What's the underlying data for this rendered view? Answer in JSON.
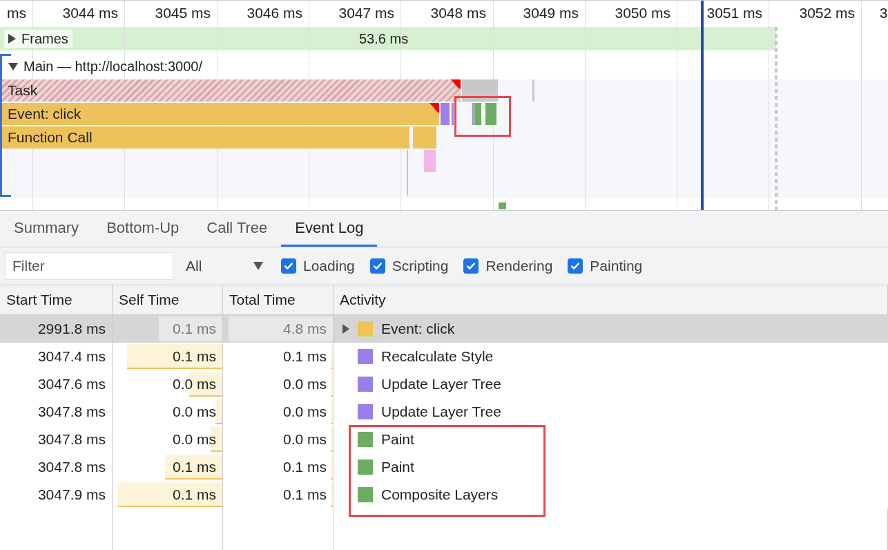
{
  "timeline": {
    "ticks": [
      "ms",
      "3044 ms",
      "3045 ms",
      "3046 ms",
      "3047 ms",
      "3048 ms",
      "3049 ms",
      "3050 ms",
      "3051 ms",
      "3052 ms",
      "3"
    ],
    "frames": {
      "label": "Frames",
      "expanded": false,
      "duration": "53.6 ms"
    },
    "main": {
      "label": "Main — http://localhost:3000/",
      "expanded": true
    },
    "events": [
      {
        "label": "Task",
        "kind": "task"
      },
      {
        "label": "Event: click",
        "kind": "scripting"
      },
      {
        "label": "Function Call",
        "kind": "scripting"
      }
    ]
  },
  "tabs": [
    {
      "label": "Summary",
      "selected": false
    },
    {
      "label": "Bottom-Up",
      "selected": false
    },
    {
      "label": "Call Tree",
      "selected": false
    },
    {
      "label": "Event Log",
      "selected": true
    }
  ],
  "filter": {
    "placeholder": "Filter"
  },
  "duration_select": {
    "value": "All"
  },
  "categories": [
    {
      "label": "Loading",
      "checked": true
    },
    {
      "label": "Scripting",
      "checked": true
    },
    {
      "label": "Rendering",
      "checked": true
    },
    {
      "label": "Painting",
      "checked": true
    }
  ],
  "table": {
    "columns": [
      "Start Time",
      "Self Time",
      "Total Time",
      "Activity"
    ],
    "rows": [
      {
        "start": "2991.8 ms",
        "self": {
          "text": "0.1 ms",
          "level": 0.58
        },
        "total": {
          "text": "4.8 ms",
          "level": 0.95
        },
        "activity": "Event: click",
        "color": "#f0c453",
        "expandable": true,
        "selected": true
      },
      {
        "start": "3047.4 ms",
        "self": {
          "text": "0.1 ms",
          "level": 0.87
        },
        "total": {
          "text": "0.1 ms",
          "level": 0.02
        },
        "activity": "Recalculate Style",
        "color": "#9b7fe6",
        "expandable": false,
        "selected": false
      },
      {
        "start": "3047.6 ms",
        "self": {
          "text": "0.0 ms",
          "level": 0.3
        },
        "total": {
          "text": "0.0 ms",
          "level": 0.02
        },
        "activity": "Update Layer Tree",
        "color": "#9b7fe6",
        "expandable": false,
        "selected": false
      },
      {
        "start": "3047.8 ms",
        "self": {
          "text": "0.0 ms",
          "level": 0.06
        },
        "total": {
          "text": "0.0 ms",
          "level": 0.02
        },
        "activity": "Update Layer Tree",
        "color": "#9b7fe6",
        "expandable": false,
        "selected": false
      },
      {
        "start": "3047.8 ms",
        "self": {
          "text": "0.0 ms",
          "level": 0.11
        },
        "total": {
          "text": "0.0 ms",
          "level": 0.02
        },
        "activity": "Paint",
        "color": "#6dac62",
        "expandable": false,
        "selected": false
      },
      {
        "start": "3047.8 ms",
        "self": {
          "text": "0.1 ms",
          "level": 0.52
        },
        "total": {
          "text": "0.1 ms",
          "level": 0.02
        },
        "activity": "Paint",
        "color": "#6dac62",
        "expandable": false,
        "selected": false
      },
      {
        "start": "3047.9 ms",
        "self": {
          "text": "0.1 ms",
          "level": 0.95
        },
        "total": {
          "text": "0.1 ms",
          "level": 0.02
        },
        "activity": "Composite Layers",
        "color": "#6dac62",
        "expandable": false,
        "selected": false
      }
    ]
  }
}
